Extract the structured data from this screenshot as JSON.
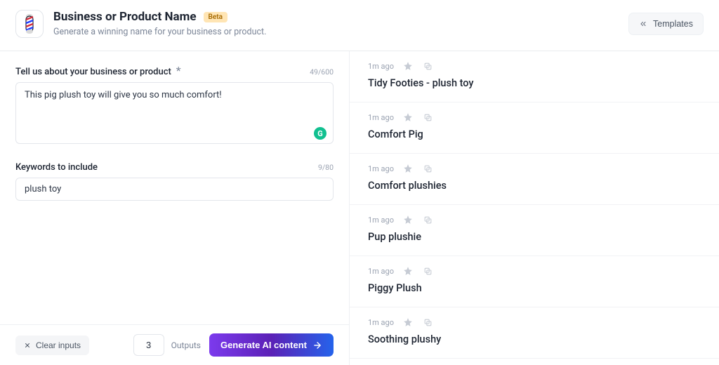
{
  "header": {
    "title": "Business or Product Name",
    "badge": "Beta",
    "subtitle": "Generate a winning name for your business or product.",
    "templates_label": "Templates"
  },
  "form": {
    "business": {
      "label": "Tell us about your business or product",
      "required_mark": "*",
      "counter": "49/600",
      "value": "This pig plush toy will give you so much comfort!"
    },
    "keywords": {
      "label": "Keywords to include",
      "counter": "9/80",
      "value": "plush toy"
    }
  },
  "action_bar": {
    "clear_label": "Clear inputs",
    "outputs_value": "3",
    "outputs_label": "Outputs",
    "generate_label": "Generate AI content"
  },
  "results": [
    {
      "age": "1m ago",
      "title": "Tidy Footies - plush toy"
    },
    {
      "age": "1m ago",
      "title": "Comfort Pig"
    },
    {
      "age": "1m ago",
      "title": "Comfort plushies"
    },
    {
      "age": "1m ago",
      "title": "Pup plushie"
    },
    {
      "age": "1m ago",
      "title": "Piggy Plush"
    },
    {
      "age": "1m ago",
      "title": "Soothing plushy"
    }
  ],
  "icons": {
    "barber_pole": "barber-pole-icon",
    "templates": "chevrons-left-icon",
    "clear": "x-icon",
    "star": "star-icon",
    "copy": "copy-icon",
    "arrow": "arrow-right-icon",
    "grammarly": "G"
  }
}
